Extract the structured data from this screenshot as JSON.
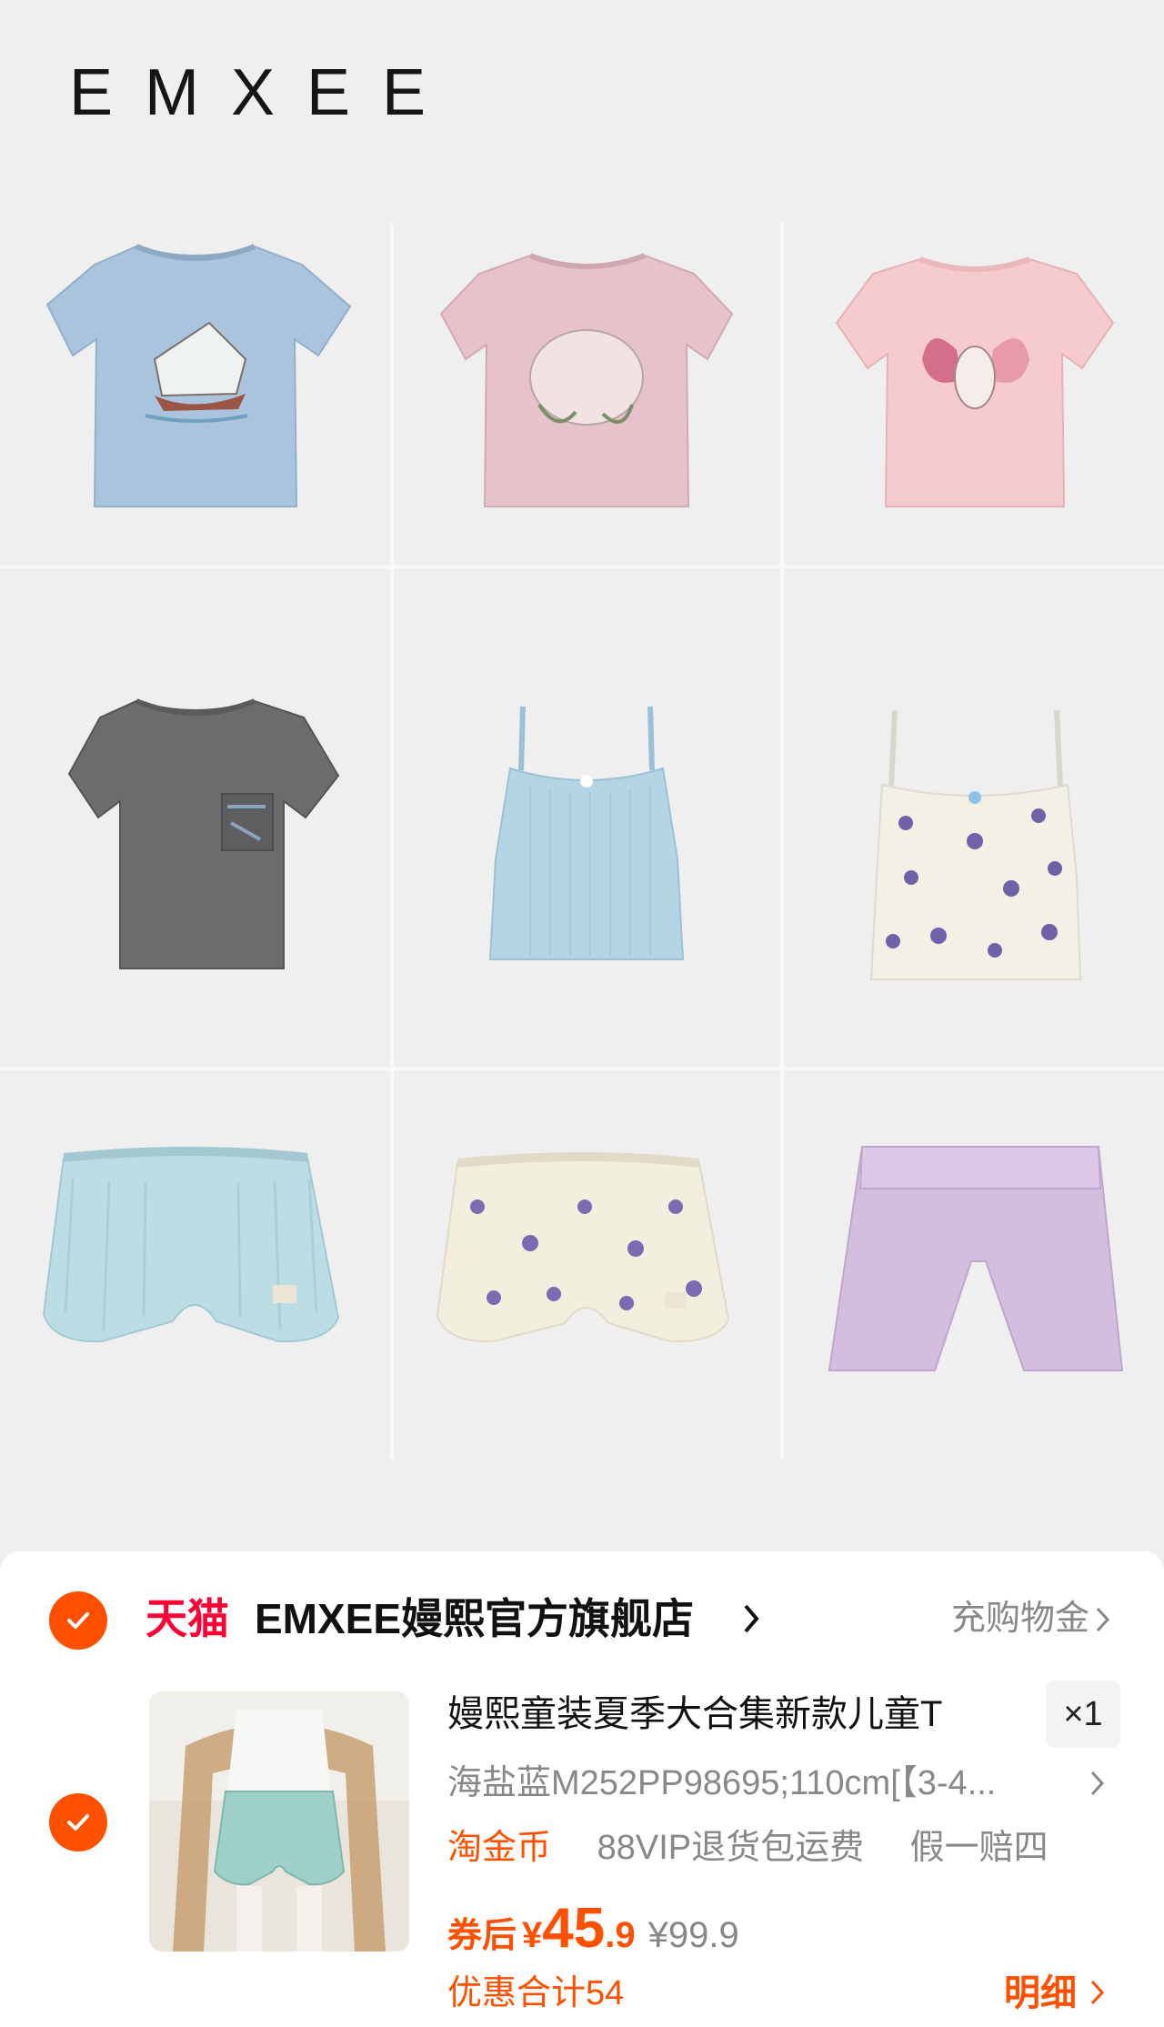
{
  "brand": {
    "logo": "EMXEE"
  },
  "products": [
    {
      "name": "blue-ship-tee",
      "color": "#a9c4dc"
    },
    {
      "name": "pink-bunny-tee",
      "color": "#e6c2ca"
    },
    {
      "name": "peach-butterfly-tee",
      "color": "#f5cbcd"
    },
    {
      "name": "gray-pocket-tee",
      "color": "#6b6c6c"
    },
    {
      "name": "blue-camisole",
      "color": "#b6d5e4"
    },
    {
      "name": "blueberry-camisole",
      "color": "#f3f0e6"
    },
    {
      "name": "blue-bloomer-shorts",
      "color": "#bcdde4"
    },
    {
      "name": "blueberry-bloomer-shorts",
      "color": "#f2efde"
    },
    {
      "name": "lilac-bike-shorts",
      "color": "#d4bedf"
    }
  ],
  "cart": {
    "store": {
      "platform": "天猫",
      "name": "EMXEE嫚熙官方旗舰店",
      "rebate": "充购物金"
    },
    "item": {
      "title": "嫚熙童装夏季大合集新款儿童T",
      "quantity": "×1",
      "sku": "海盐蓝M252PP98695;110cm[【3-4...",
      "tags": {
        "coin": "淘金币",
        "vip": "88VIP退货包运费",
        "fake": "假一赔四"
      },
      "price_label": "券后",
      "currency": "¥",
      "price_int": "45",
      "price_dec": ".9",
      "original_price": "¥99.9",
      "discount_total": "优惠合计54",
      "detail_label": "明细"
    }
  },
  "colors": {
    "accent": "#ff5000",
    "tmall_red": "#ff0036"
  }
}
